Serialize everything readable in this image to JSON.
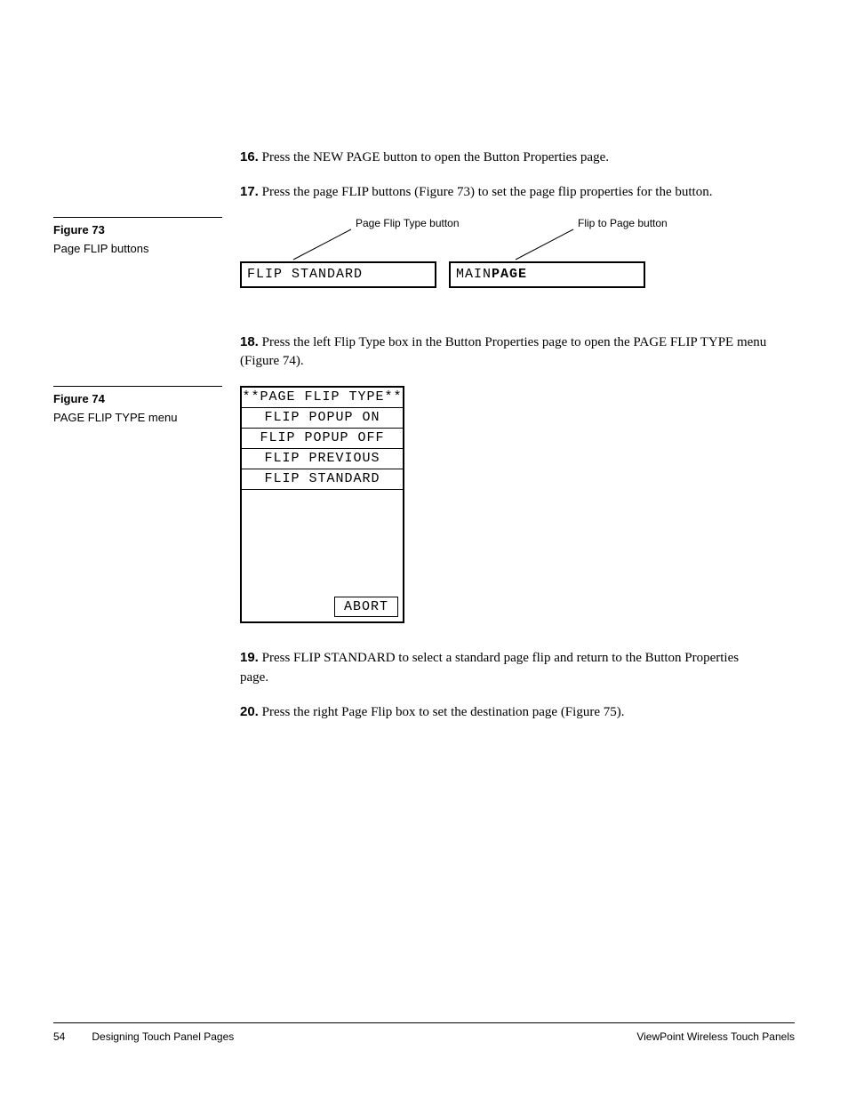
{
  "steps": {
    "s16": {
      "num": "16.",
      "text": "Press the NEW PAGE button to open the Button Properties page."
    },
    "s17": {
      "num": "17.",
      "text": "Press the page FLIP buttons (Figure 73) to set the page flip properties for the button."
    },
    "s18": {
      "num": "18.",
      "text": "Press the left Flip Type box in the Button Properties page to open the PAGE FLIP TYPE menu (Figure 74)."
    },
    "s19": {
      "num": "19.",
      "text": "Press FLIP STANDARD to select a standard page flip and return to the Button Properties page."
    },
    "s20": {
      "num": "20.",
      "text": "Press the right Page Flip box to set the destination page (Figure 75)."
    }
  },
  "fig73": {
    "label": "Figure 73",
    "desc": "Page FLIP buttons",
    "callout_left": "Page Flip Type button",
    "callout_right": "Flip to Page button",
    "box_left": "FLIP STANDARD",
    "box_right_a": "MAIN ",
    "box_right_b": "PAGE"
  },
  "fig74": {
    "label": "Figure 74",
    "desc": "PAGE FLIP TYPE menu",
    "title": "**PAGE FLIP TYPE**",
    "rows": [
      "FLIP POPUP ON",
      "FLIP POPUP OFF",
      "FLIP PREVIOUS",
      "FLIP STANDARD"
    ],
    "abort": "ABORT"
  },
  "footer": {
    "page": "54",
    "section": "Designing Touch Panel Pages",
    "doc": "ViewPoint Wireless Touch Panels"
  }
}
